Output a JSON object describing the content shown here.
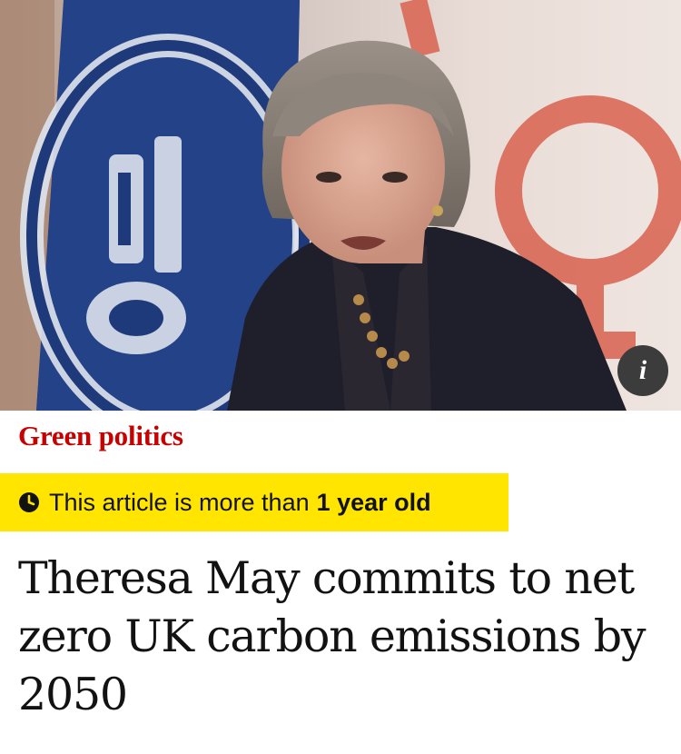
{
  "article": {
    "image": {
      "alt": "Theresa May speaking in front of flags",
      "info_icon": "info-icon",
      "info_glyph": "i"
    },
    "kicker": "Green politics",
    "age_banner": {
      "icon": "clock-icon",
      "text": "This article is more than",
      "highlight": "1 year old"
    },
    "headline": "Theresa May commits to net zero UK carbon emissions by 2050"
  },
  "colors": {
    "kicker": "#c70000",
    "banner_background": "#ffe500",
    "text": "#121212",
    "info_button": "#3c3c3c"
  }
}
